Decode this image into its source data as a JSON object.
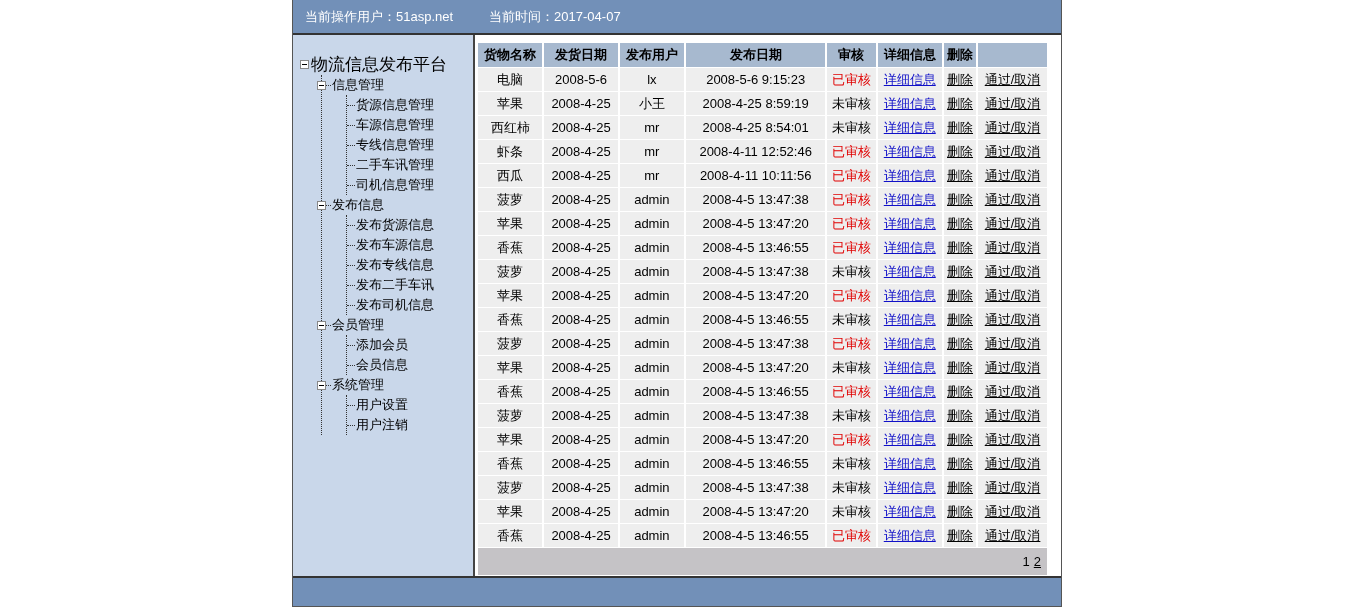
{
  "header": {
    "user_label": "当前操作用户：51asp.net",
    "time_label": "当前时间：2017-04-07"
  },
  "tree": {
    "label": "物流信息发布平台",
    "expanded": true,
    "children": [
      {
        "label": "信息管理",
        "expanded": true,
        "children": [
          {
            "label": "货源信息管理"
          },
          {
            "label": "车源信息管理"
          },
          {
            "label": "专线信息管理"
          },
          {
            "label": "二手车讯管理"
          },
          {
            "label": "司机信息管理"
          }
        ]
      },
      {
        "label": "发布信息",
        "expanded": true,
        "children": [
          {
            "label": "发布货源信息"
          },
          {
            "label": "发布车源信息"
          },
          {
            "label": "发布专线信息"
          },
          {
            "label": "发布二手车讯"
          },
          {
            "label": "发布司机信息"
          }
        ]
      },
      {
        "label": "会员管理",
        "expanded": true,
        "children": [
          {
            "label": "添加会员"
          },
          {
            "label": "会员信息"
          }
        ]
      },
      {
        "label": "系统管理",
        "expanded": true,
        "children": [
          {
            "label": "用户设置"
          },
          {
            "label": "用户注销"
          }
        ]
      }
    ]
  },
  "table": {
    "columns": [
      "货物名称",
      "发货日期",
      "发布用户",
      "发布日期",
      "审核",
      "详细信息",
      "删除"
    ],
    "rows": [
      {
        "name": "电脑",
        "ship_date": "2008-5-6",
        "user": "lx",
        "publish_date": "2008-5-6 9:15:23",
        "status": "已审核",
        "approved": true,
        "detail": "详细信息",
        "delete": "删除",
        "toggle": "通过/取消"
      },
      {
        "name": "苹果",
        "ship_date": "2008-4-25",
        "user": "小王",
        "publish_date": "2008-4-25 8:59:19",
        "status": "未审核",
        "approved": false,
        "detail": "详细信息",
        "delete": "删除",
        "toggle": "通过/取消"
      },
      {
        "name": "西红柿",
        "ship_date": "2008-4-25",
        "user": "mr",
        "publish_date": "2008-4-25 8:54:01",
        "status": "未审核",
        "approved": false,
        "detail": "详细信息",
        "delete": "删除",
        "toggle": "通过/取消"
      },
      {
        "name": "虾条",
        "ship_date": "2008-4-25",
        "user": "mr",
        "publish_date": "2008-4-11 12:52:46",
        "status": "已审核",
        "approved": true,
        "detail": "详细信息",
        "delete": "删除",
        "toggle": "通过/取消"
      },
      {
        "name": "西瓜",
        "ship_date": "2008-4-25",
        "user": "mr",
        "publish_date": "2008-4-11 10:11:56",
        "status": "已审核",
        "approved": true,
        "detail": "详细信息",
        "delete": "删除",
        "toggle": "通过/取消"
      },
      {
        "name": "菠萝",
        "ship_date": "2008-4-25",
        "user": "admin",
        "publish_date": "2008-4-5 13:47:38",
        "status": "已审核",
        "approved": true,
        "detail": "详细信息",
        "delete": "删除",
        "toggle": "通过/取消"
      },
      {
        "name": "苹果",
        "ship_date": "2008-4-25",
        "user": "admin",
        "publish_date": "2008-4-5 13:47:20",
        "status": "已审核",
        "approved": true,
        "detail": "详细信息",
        "delete": "删除",
        "toggle": "通过/取消"
      },
      {
        "name": "香蕉",
        "ship_date": "2008-4-25",
        "user": "admin",
        "publish_date": "2008-4-5 13:46:55",
        "status": "已审核",
        "approved": true,
        "detail": "详细信息",
        "delete": "删除",
        "toggle": "通过/取消"
      },
      {
        "name": "菠萝",
        "ship_date": "2008-4-25",
        "user": "admin",
        "publish_date": "2008-4-5 13:47:38",
        "status": "未审核",
        "approved": false,
        "detail": "详细信息",
        "delete": "删除",
        "toggle": "通过/取消"
      },
      {
        "name": "苹果",
        "ship_date": "2008-4-25",
        "user": "admin",
        "publish_date": "2008-4-5 13:47:20",
        "status": "已审核",
        "approved": true,
        "detail": "详细信息",
        "delete": "删除",
        "toggle": "通过/取消"
      },
      {
        "name": "香蕉",
        "ship_date": "2008-4-25",
        "user": "admin",
        "publish_date": "2008-4-5 13:46:55",
        "status": "未审核",
        "approved": false,
        "detail": "详细信息",
        "delete": "删除",
        "toggle": "通过/取消"
      },
      {
        "name": "菠萝",
        "ship_date": "2008-4-25",
        "user": "admin",
        "publish_date": "2008-4-5 13:47:38",
        "status": "已审核",
        "approved": true,
        "detail": "详细信息",
        "delete": "删除",
        "toggle": "通过/取消"
      },
      {
        "name": "苹果",
        "ship_date": "2008-4-25",
        "user": "admin",
        "publish_date": "2008-4-5 13:47:20",
        "status": "未审核",
        "approved": false,
        "detail": "详细信息",
        "delete": "删除",
        "toggle": "通过/取消"
      },
      {
        "name": "香蕉",
        "ship_date": "2008-4-25",
        "user": "admin",
        "publish_date": "2008-4-5 13:46:55",
        "status": "已审核",
        "approved": true,
        "detail": "详细信息",
        "delete": "删除",
        "toggle": "通过/取消"
      },
      {
        "name": "菠萝",
        "ship_date": "2008-4-25",
        "user": "admin",
        "publish_date": "2008-4-5 13:47:38",
        "status": "未审核",
        "approved": false,
        "detail": "详细信息",
        "delete": "删除",
        "toggle": "通过/取消"
      },
      {
        "name": "苹果",
        "ship_date": "2008-4-25",
        "user": "admin",
        "publish_date": "2008-4-5 13:47:20",
        "status": "已审核",
        "approved": true,
        "detail": "详细信息",
        "delete": "删除",
        "toggle": "通过/取消"
      },
      {
        "name": "香蕉",
        "ship_date": "2008-4-25",
        "user": "admin",
        "publish_date": "2008-4-5 13:46:55",
        "status": "未审核",
        "approved": false,
        "detail": "详细信息",
        "delete": "删除",
        "toggle": "通过/取消"
      },
      {
        "name": "菠萝",
        "ship_date": "2008-4-25",
        "user": "admin",
        "publish_date": "2008-4-5 13:47:38",
        "status": "未审核",
        "approved": false,
        "detail": "详细信息",
        "delete": "删除",
        "toggle": "通过/取消"
      },
      {
        "name": "苹果",
        "ship_date": "2008-4-25",
        "user": "admin",
        "publish_date": "2008-4-5 13:47:20",
        "status": "未审核",
        "approved": false,
        "detail": "详细信息",
        "delete": "删除",
        "toggle": "通过/取消"
      },
      {
        "name": "香蕉",
        "ship_date": "2008-4-25",
        "user": "admin",
        "publish_date": "2008-4-5 13:46:55",
        "status": "已审核",
        "approved": true,
        "detail": "详细信息",
        "delete": "删除",
        "toggle": "通过/取消"
      }
    ],
    "pages": [
      {
        "label": "1",
        "selected": true
      },
      {
        "label": "2",
        "selected": false
      }
    ]
  }
}
